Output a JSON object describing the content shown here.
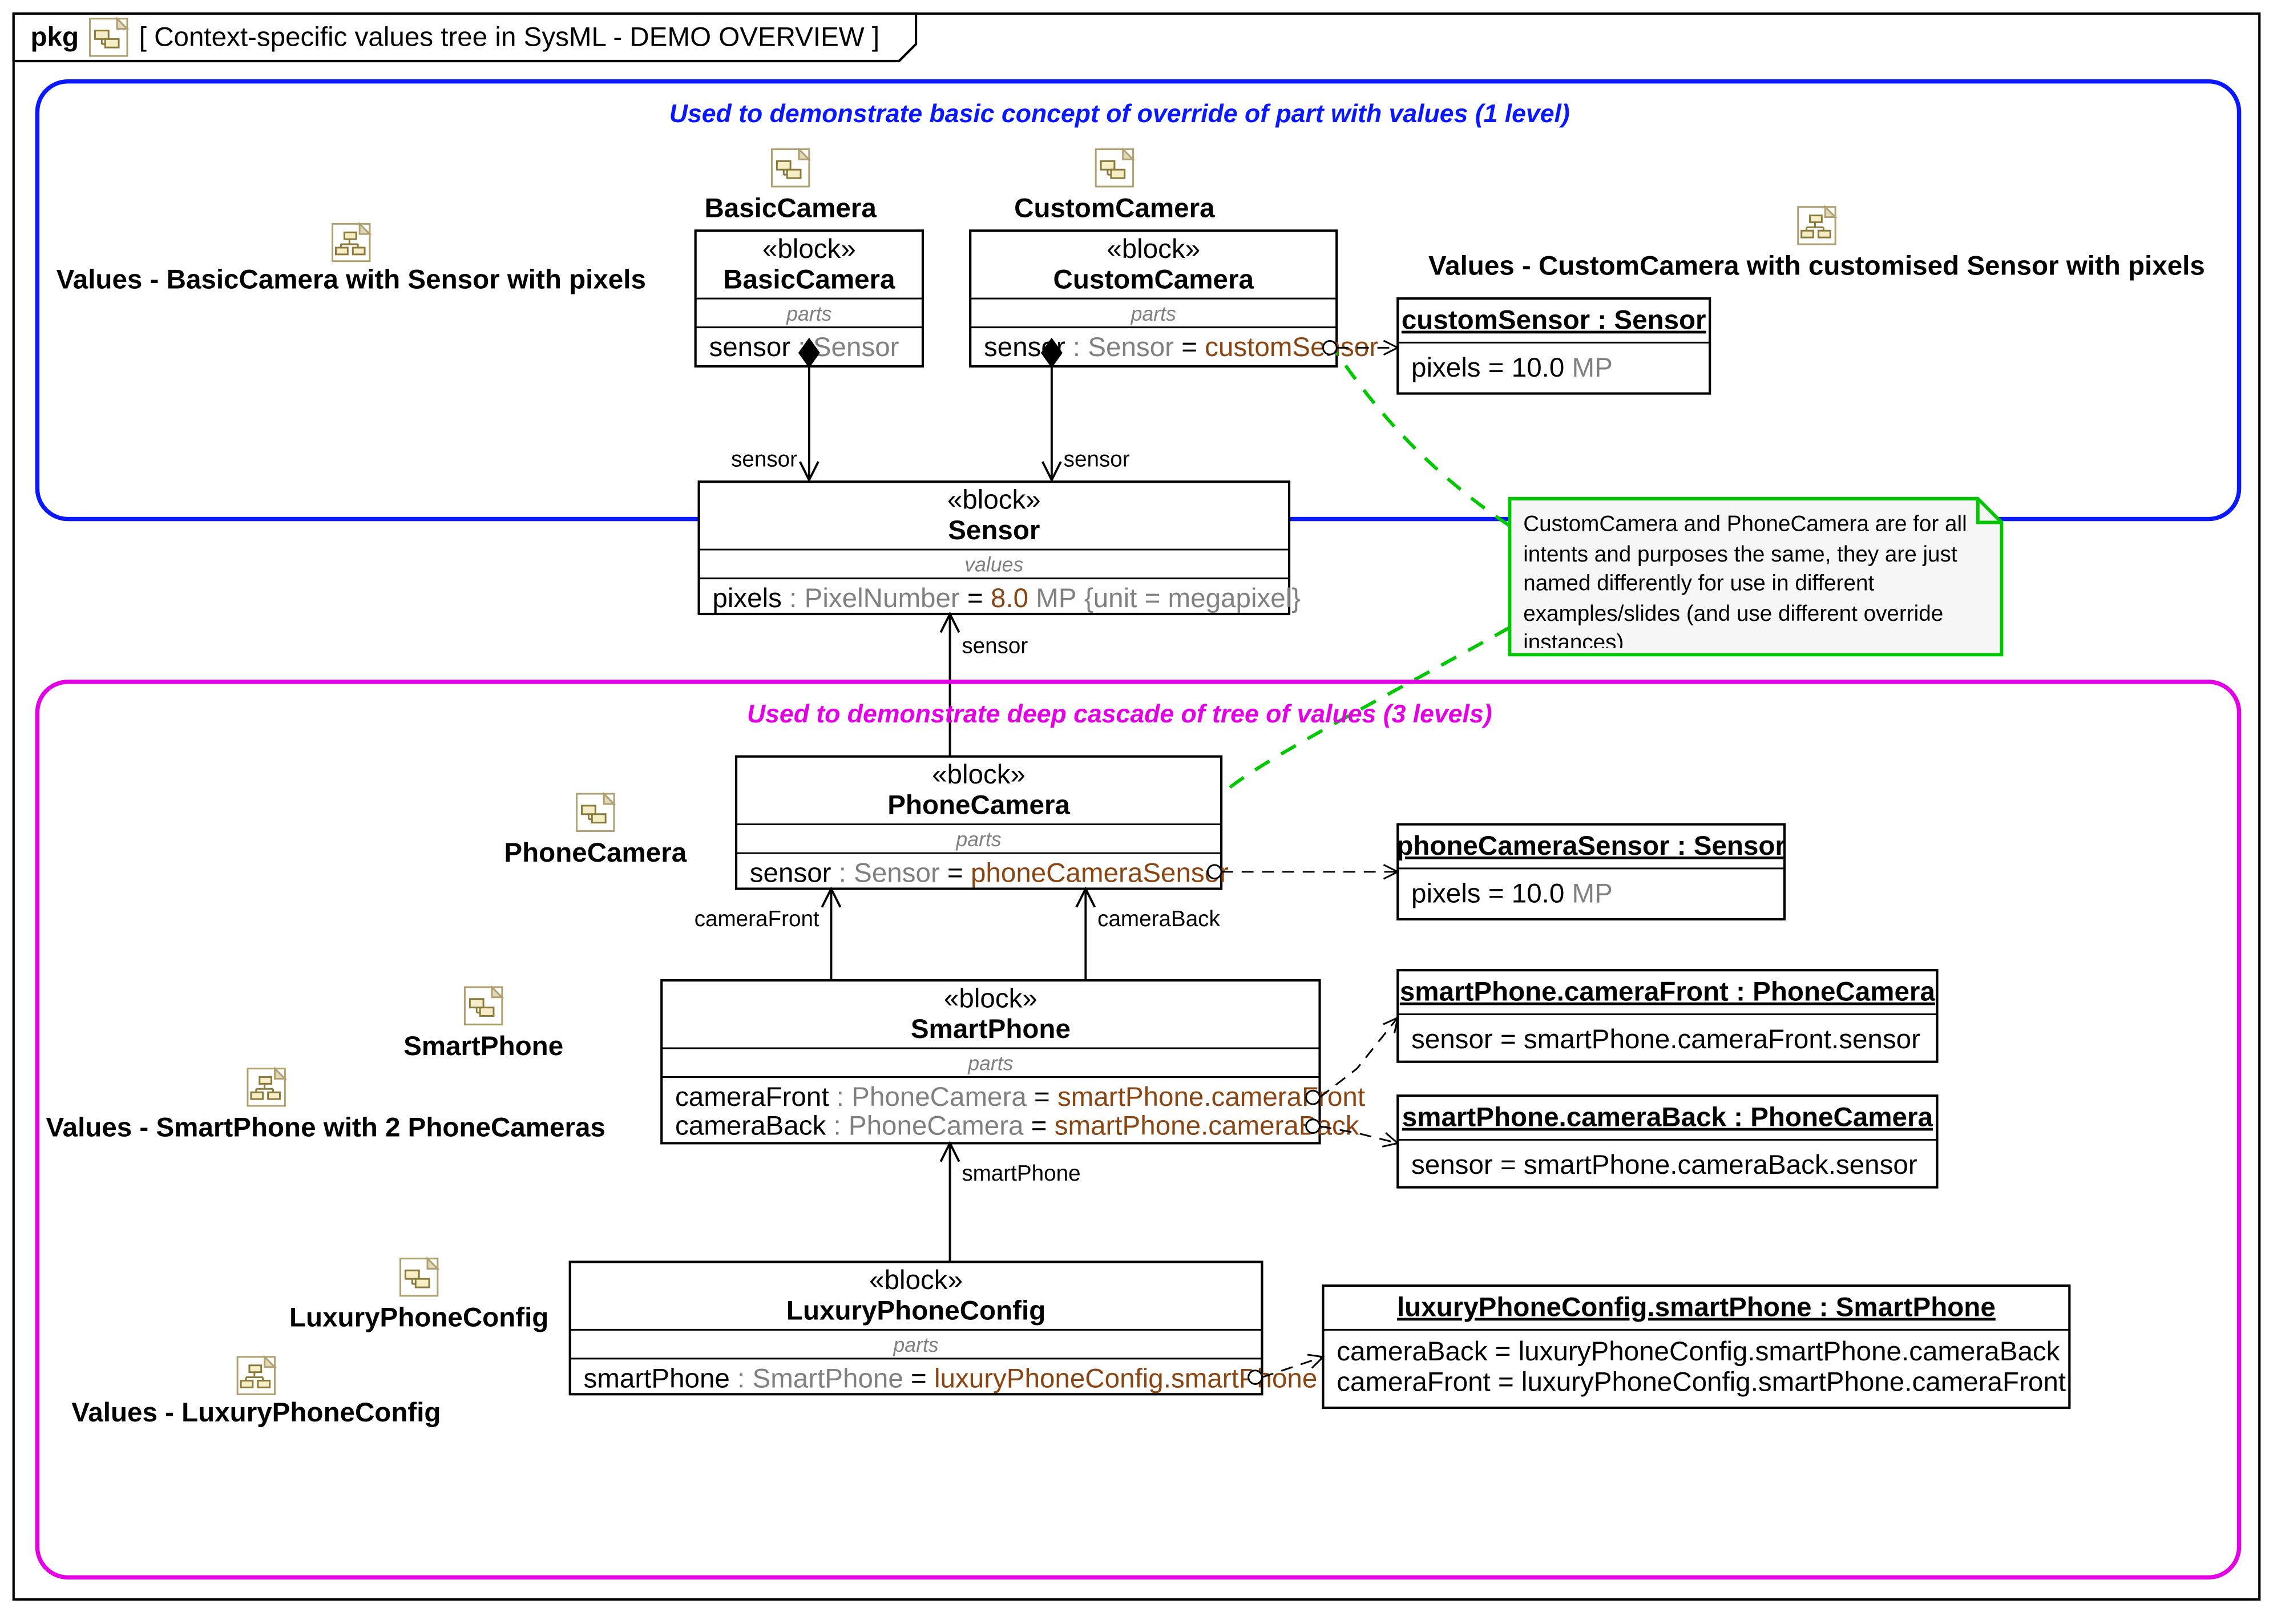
{
  "frame": {
    "keyword": "pkg",
    "title": "Context-specific values tree in SysML - DEMO OVERVIEW"
  },
  "sectionTitles": {
    "top": "Used to demonstrate basic concept of override of part with values (1 level)",
    "bottom": "Used to demonstrate deep cascade of tree of values (3 levels)"
  },
  "externalLabels": {
    "basicCamera": "BasicCamera",
    "customCamera": "CustomCamera",
    "valuesBasic": "Values - BasicCamera with Sensor with pixels",
    "valuesCustom": "Values - CustomCamera with customised Sensor with pixels",
    "phoneCamera": "PhoneCamera",
    "smartPhone": "SmartPhone",
    "valuesSmart": "Values - SmartPhone with 2 PhoneCameras",
    "luxuryConfig": "LuxuryPhoneConfig",
    "valuesLuxury": "Values - LuxuryPhoneConfig"
  },
  "note": "CustomCamera and PhoneCamera are for all intents and purposes the same, they are just named differently for use in different examples/slides (and use different override instances)",
  "stereotype": "«block»",
  "compartmentLabels": {
    "parts": "parts",
    "values": "values"
  },
  "roleLabels": {
    "sensor": "sensor",
    "cameraFront": "cameraFront",
    "cameraBack": "cameraBack",
    "smartPhone": "smartPhone"
  },
  "blocks": {
    "basicCamera": {
      "name": "BasicCamera",
      "part1_pre": "sensor",
      "part1_type": "Sensor"
    },
    "customCamera": {
      "name": "CustomCamera",
      "part1_pre": "sensor",
      "part1_type": "Sensor",
      "part1_default": "customSensor"
    },
    "sensor": {
      "name": "Sensor",
      "val_name": "pixels",
      "val_type": "PixelNumber",
      "val_default": "8.0",
      "val_unit1": "MP",
      "val_constraint": "{unit = megapixel}"
    },
    "phoneCamera": {
      "name": "PhoneCamera",
      "part1_pre": "sensor",
      "part1_type": "Sensor",
      "part1_default": "phoneCameraSensor"
    },
    "smartPhone": {
      "name": "SmartPhone",
      "p1_pre": "cameraFront",
      "p1_type": "PhoneCamera",
      "p1_default": "smartPhone.cameraFront",
      "p2_pre": "cameraBack",
      "p2_type": "PhoneCamera",
      "p2_default": "smartPhone.cameraBack"
    },
    "luxury": {
      "name": "LuxuryPhoneConfig",
      "p1_pre": "smartPhone",
      "p1_type": "SmartPhone",
      "p1_default": "luxuryPhoneConfig.smartPhone"
    }
  },
  "instances": {
    "customSensor": {
      "title": "customSensor : Sensor",
      "slot_name": "pixels",
      "slot_val": "10.0",
      "slot_unit": "MP"
    },
    "phoneCameraSensor": {
      "title": "phoneCameraSensor : Sensor",
      "slot_name": "pixels",
      "slot_val": "10.0",
      "slot_unit": "MP"
    },
    "spFront": {
      "title": "smartPhone.cameraFront : PhoneCamera",
      "slot": "sensor = smartPhone.cameraFront.sensor"
    },
    "spBack": {
      "title": "smartPhone.cameraBack : PhoneCamera",
      "slot": "sensor = smartPhone.cameraBack.sensor"
    },
    "luxSP": {
      "title": "luxuryPhoneConfig.smartPhone : SmartPhone",
      "s1": "cameraBack = luxuryPhoneConfig.smartPhone.cameraBack",
      "s2": "cameraFront = luxuryPhoneConfig.smartPhone.cameraFront"
    }
  },
  "glue": {
    "colon": " : ",
    "equals": " = "
  }
}
